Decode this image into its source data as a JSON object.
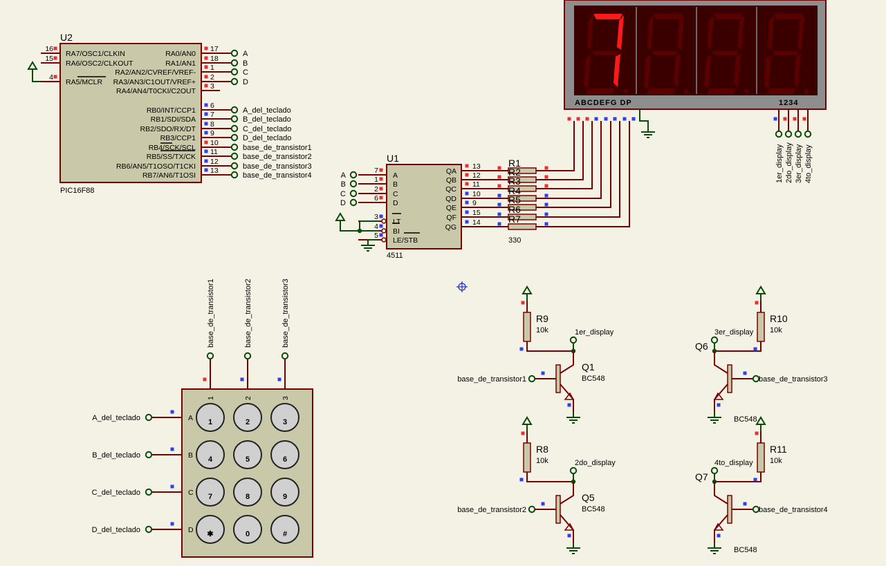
{
  "u2": {
    "ref": "U2",
    "part": "PIC16F88",
    "left_pins": [
      {
        "num": "16",
        "name": "RA7/OSC1/CLKIN"
      },
      {
        "num": "15",
        "name": "RA6/OSC2/CLKOUT"
      },
      {
        "num": "4",
        "name": "RA5/MCLR"
      }
    ],
    "right_pins": [
      {
        "num": "17",
        "name": "RA0/AN0",
        "net": "A"
      },
      {
        "num": "18",
        "name": "RA1/AN1",
        "net": "B"
      },
      {
        "num": "1",
        "name": "RA2/AN2/CVREF/VREF-",
        "net": "C"
      },
      {
        "num": "2",
        "name": "RA3/AN3/C1OUT/VREF+",
        "net": "D"
      },
      {
        "num": "3",
        "name": "RA4/AN4/T0CKI/C2OUT",
        "net": ""
      },
      {
        "num": "6",
        "name": "RB0/INT/CCP1",
        "net": "A_del_teclado"
      },
      {
        "num": "7",
        "name": "RB1/SDI/SDA",
        "net": "B_del_teclado"
      },
      {
        "num": "8",
        "name": "RB2/SDO/RX/DT",
        "net": "C_del_teclado"
      },
      {
        "num": "9",
        "name": "RB3/CCP1",
        "net": "D_del_teclado"
      },
      {
        "num": "10",
        "name": "RB4/SCK/SCL",
        "net": "base_de_transistor1"
      },
      {
        "num": "11",
        "name": "RB5/SS/TX/CK",
        "net": "base_de_transistor2"
      },
      {
        "num": "12",
        "name": "RB6/AN5/T1OSO/T1CKI",
        "net": "base_de_transistor3"
      },
      {
        "num": "13",
        "name": "RB7/AN6/T1OSI",
        "net": "base_de_transistor4"
      }
    ]
  },
  "u1": {
    "ref": "U1",
    "part": "4511",
    "left_pins": [
      {
        "num": "7",
        "name": "A",
        "net": "A"
      },
      {
        "num": "1",
        "name": "B",
        "net": "B"
      },
      {
        "num": "2",
        "name": "C",
        "net": "C"
      },
      {
        "num": "6",
        "name": "D",
        "net": "D"
      },
      {
        "num": "3",
        "name": "LT",
        "net": ""
      },
      {
        "num": "4",
        "name": "BI",
        "net": ""
      },
      {
        "num": "5",
        "name": "LE/STB",
        "net": ""
      }
    ],
    "right_pins": [
      {
        "num": "13",
        "name": "QA"
      },
      {
        "num": "12",
        "name": "QB"
      },
      {
        "num": "11",
        "name": "QC"
      },
      {
        "num": "10",
        "name": "QD"
      },
      {
        "num": "9",
        "name": "QE"
      },
      {
        "num": "15",
        "name": "QF"
      },
      {
        "num": "14",
        "name": "QG"
      }
    ]
  },
  "resistor_pack": {
    "refs": [
      "R1",
      "R2",
      "R3",
      "R4",
      "R5",
      "R6",
      "R7"
    ],
    "value": "330"
  },
  "display": {
    "digits": [
      "7",
      "8",
      "8",
      "8"
    ],
    "segment_labels": "ABCDEFG DP",
    "common_labels": "1234",
    "common_nets": [
      "1er_display",
      "2do_display",
      "3er_display",
      "4to_display"
    ],
    "lit_color": "#ff1a1a",
    "dim_color": "#5a0000"
  },
  "keypad": {
    "columns": [
      "1",
      "2",
      "3"
    ],
    "column_nets": [
      "base_de_transistor1",
      "base_de_transistor2",
      "base_de_transistor3"
    ],
    "rows": [
      "A",
      "B",
      "C",
      "D"
    ],
    "row_nets": [
      "A_del_teclado",
      "B_del_teclado",
      "C_del_teclado",
      "D_del_teclado"
    ],
    "keys": [
      "1",
      "2",
      "3",
      "4",
      "5",
      "6",
      "7",
      "8",
      "9",
      "✱",
      "0",
      "#"
    ]
  },
  "transistors": [
    {
      "q": "Q1",
      "type": "BC548",
      "r": "R9",
      "rval": "10k",
      "collector_net": "1er_display",
      "base_net": "base_de_transistor1"
    },
    {
      "q": "Q5",
      "type": "BC548",
      "r": "R8",
      "rval": "10k",
      "collector_net": "2do_display",
      "base_net": "base_de_transistor2"
    },
    {
      "q": "Q6",
      "type": "BC548",
      "r": "R10",
      "rval": "10k",
      "collector_net": "3er_display",
      "base_net": "base_de_transistor3"
    },
    {
      "q": "Q7",
      "type": "BC548",
      "r": "R11",
      "rval": "10k",
      "collector_net": "4to_display",
      "base_net": "base_de_transistor4"
    }
  ]
}
